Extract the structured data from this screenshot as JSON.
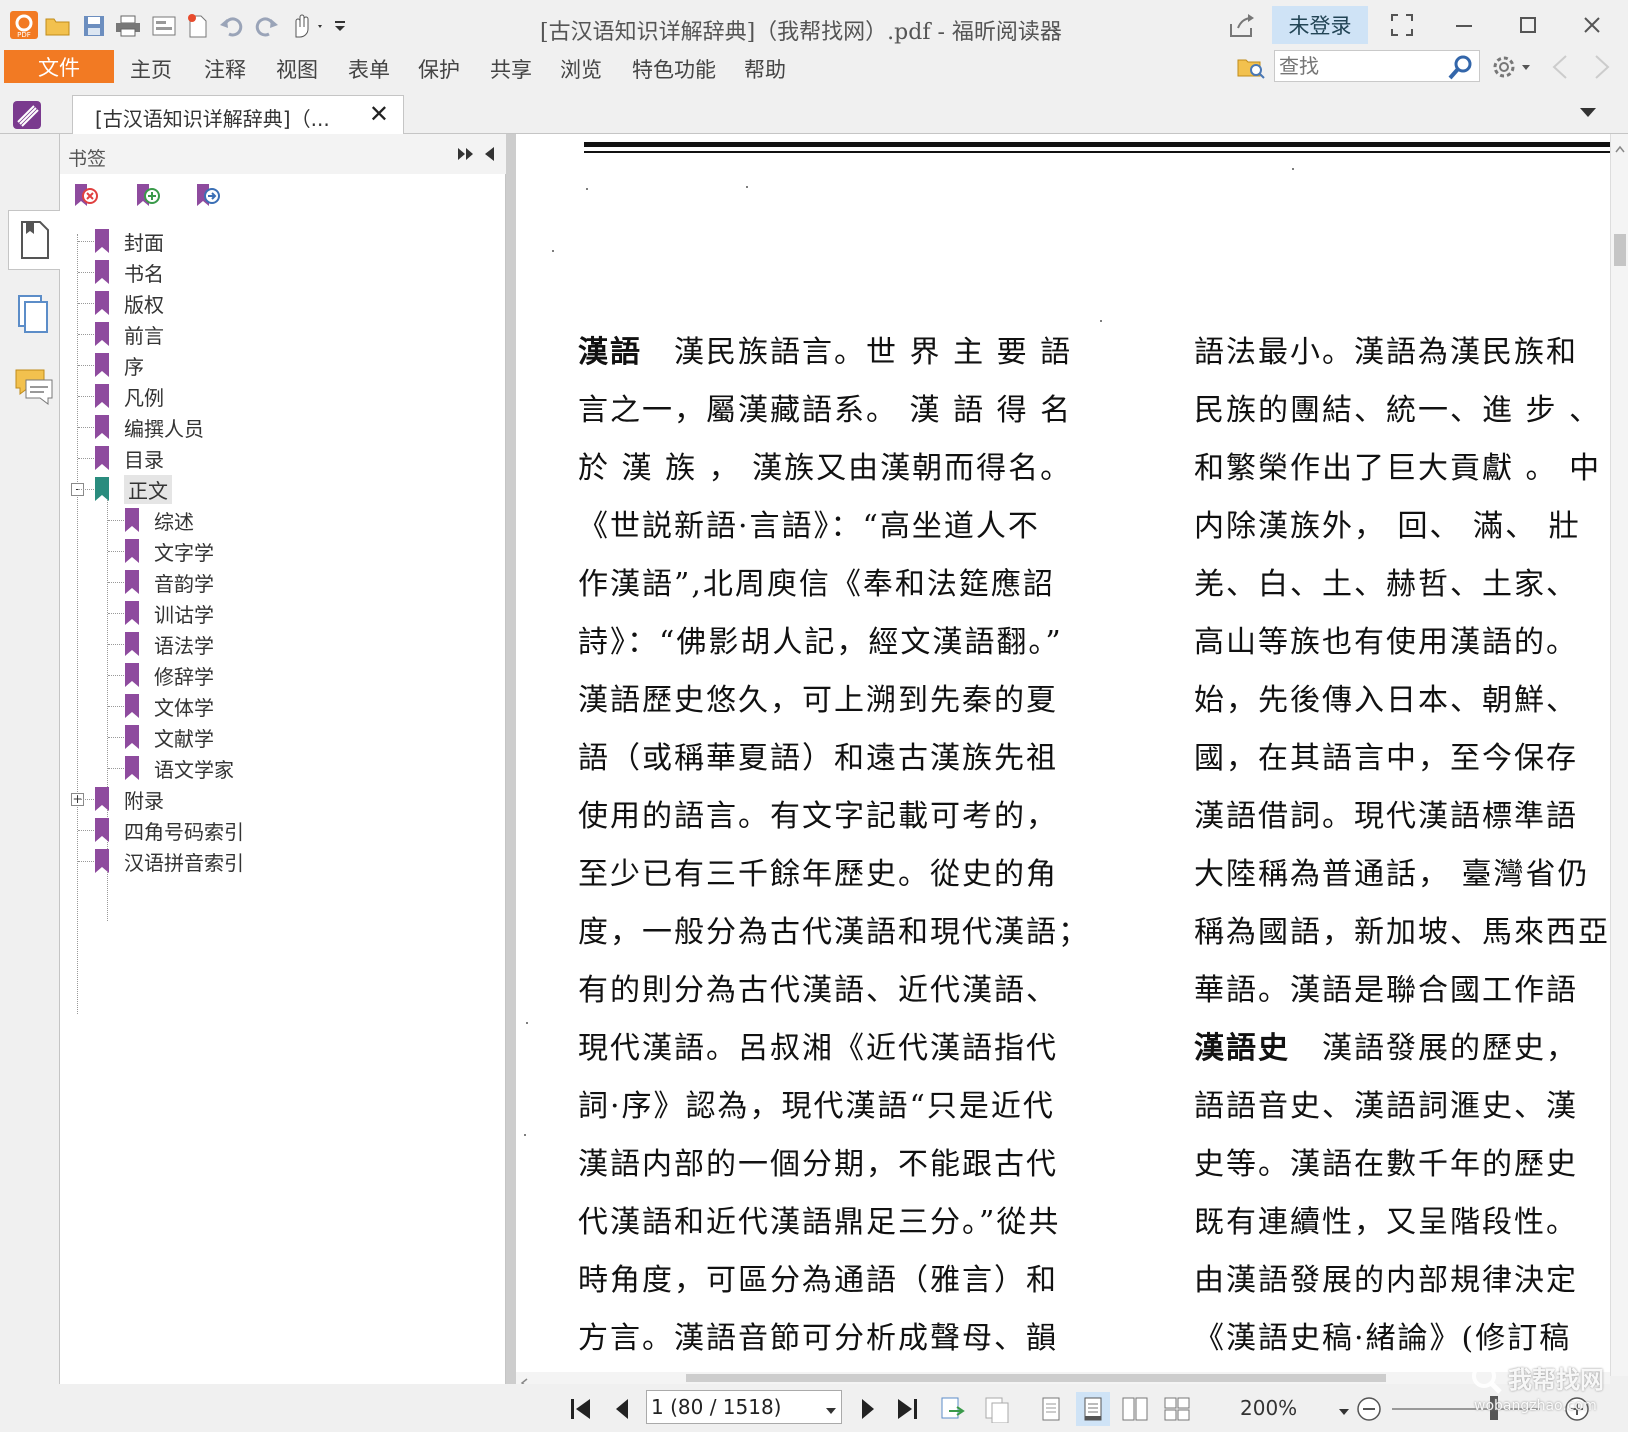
{
  "app": {
    "title": "[古汉语知识详解辞典]（我帮找网）.pdf - 福昕阅读器",
    "login_label": "未登录"
  },
  "menu": {
    "file": "文件",
    "items": [
      "主页",
      "注释",
      "视图",
      "表单",
      "保护",
      "共享",
      "浏览",
      "特色功能",
      "帮助"
    ]
  },
  "search": {
    "placeholder": "查找"
  },
  "tab": {
    "label": "[古汉语知识详解辞典]（..."
  },
  "bookmarks": {
    "title": "书签",
    "items": [
      {
        "label": "封面"
      },
      {
        "label": "书名"
      },
      {
        "label": "版权"
      },
      {
        "label": "前言"
      },
      {
        "label": "序"
      },
      {
        "label": "凡例"
      },
      {
        "label": "编撰人员"
      },
      {
        "label": "目录"
      },
      {
        "label": "正文"
      }
    ],
    "children": [
      {
        "label": "综述"
      },
      {
        "label": "文字学"
      },
      {
        "label": "音韵学"
      },
      {
        "label": "训诂学"
      },
      {
        "label": "语法学"
      },
      {
        "label": "修辞学"
      },
      {
        "label": "文体学"
      },
      {
        "label": "文献学"
      },
      {
        "label": "语文学家"
      }
    ],
    "after": [
      {
        "label": "附录"
      },
      {
        "label": "四角号码索引"
      },
      {
        "label": "汉语拼音索引"
      }
    ]
  },
  "document": {
    "left_column": [
      {
        "head": "漢語",
        "text": "　漢民族語言。世 界 主 要 語"
      },
      {
        "text": "言之一，屬漢藏語系。 漢 語 得 名"
      },
      {
        "text": "於 漢 族 ， 漢族又由漢朝而得名。"
      },
      {
        "text": "《世説新語·言語》：“高坐道人不"
      },
      {
        "text": "作漢語”,北周庾信《奉和法筵應詔"
      },
      {
        "text": "詩》：“佛影胡人記，經文漢語翻。”"
      },
      {
        "text": "漢語歷史悠久，可上溯到先秦的夏"
      },
      {
        "text": "語（或稱華夏語）和遠古漢族先祖"
      },
      {
        "text": "使用的語言。有文字記載可考的，"
      },
      {
        "text": "至少已有三千餘年歷史。從史的角"
      },
      {
        "text": "度，一般分為古代漢語和現代漢語；"
      },
      {
        "text": "有的則分為古代漢語、近代漢語、"
      },
      {
        "text": "現代漢語。呂叔湘《近代漢語指代"
      },
      {
        "text": "詞·序》認為，現代漢語“只是近代"
      },
      {
        "text": "漢語内部的一個分期，不能跟古代"
      },
      {
        "text": "代漢語和近代漢語鼎足三分。”從共"
      },
      {
        "text": "時角度，可區分為通語（雅言）和"
      },
      {
        "text": "方言。漢語音節可分析成聲母、韻"
      }
    ],
    "right_column": [
      {
        "text": "語法最小。漢語為漢民族和"
      },
      {
        "text": "民族的團結、統一、進 步 、"
      },
      {
        "text": "和繁榮作出了巨大貢獻 。 中"
      },
      {
        "text": "内除漢族外， 回、 滿、 壯"
      },
      {
        "text": "羌、白、土、赫哲、土家、"
      },
      {
        "text": "高山等族也有使用漢語的。"
      },
      {
        "text": "始，先後傳入日本、朝鮮、"
      },
      {
        "text": "國，在其語言中，至今保存"
      },
      {
        "text": "漢語借詞。現代漢語標準語"
      },
      {
        "text": "大陸稱為普通話， 臺灣省仍"
      },
      {
        "text": "稱為國語，新加坡、馬來西亞"
      },
      {
        "text": "華語。漢語是聯合國工作語"
      },
      {
        "head": "漢語史",
        "text": "　漢語發展的歷史，"
      },
      {
        "text": "語語音史、漢語詞滙史、漢"
      },
      {
        "text": "史等。漢語在數千年的歷史"
      },
      {
        "text": "既有連續性，又呈階段性。"
      },
      {
        "text": "由漢語發展的内部規律決定"
      },
      {
        "text": "《漢語史稿·緒論》(修訂稿"
      }
    ]
  },
  "status": {
    "page_value": "1 (80 / 1518)",
    "zoom": "200%"
  },
  "watermark": {
    "text": "我帮找网",
    "sub": "wobangzhao.com"
  },
  "colors": {
    "accent": "#f27a23",
    "bookmark": "#8e4b9e",
    "bookmark_active": "#2a8c7e",
    "active_bg": "#cfe3f6"
  }
}
